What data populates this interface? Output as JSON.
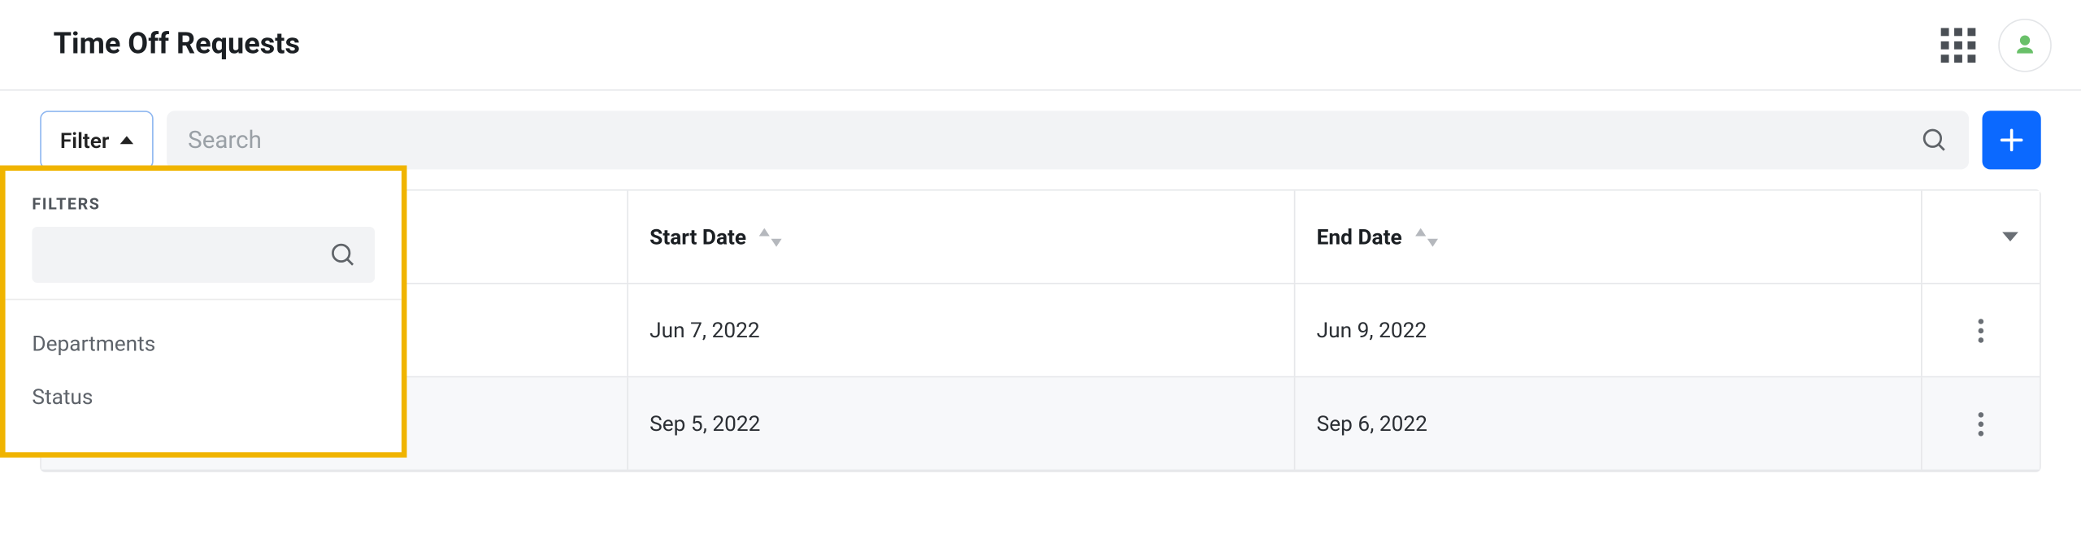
{
  "header": {
    "title": "Time Off Requests"
  },
  "toolbar": {
    "filter_label": "Filter",
    "search_placeholder": "Search"
  },
  "filters_panel": {
    "caption": "FILTERS",
    "items": [
      "Departments",
      "Status"
    ]
  },
  "columns": {
    "start": "Start Date",
    "end": "End Date"
  },
  "rows": [
    {
      "start": "Jun 7, 2022",
      "end": "Jun 9, 2022"
    },
    {
      "start": "Sep 5, 2022",
      "end": "Sep 6, 2022"
    }
  ]
}
